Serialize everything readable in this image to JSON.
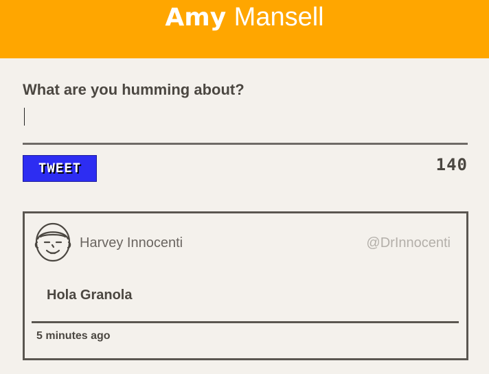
{
  "header": {
    "first_name": "Amy",
    "last_name": "Mansell",
    "background_color": "#ffa600"
  },
  "compose": {
    "label": "What are you humming about?",
    "value": "",
    "placeholder": "",
    "button_label": "TWEET",
    "button_color": "#2d2df2",
    "char_count": "140"
  },
  "tweets": [
    {
      "author_name": "Harvey Innocenti",
      "handle": "@DrInnocenti",
      "avatar_icon": "smiling-face-avatar-icon",
      "text": "Hola Granola",
      "timestamp": "5 minutes ago"
    }
  ]
}
